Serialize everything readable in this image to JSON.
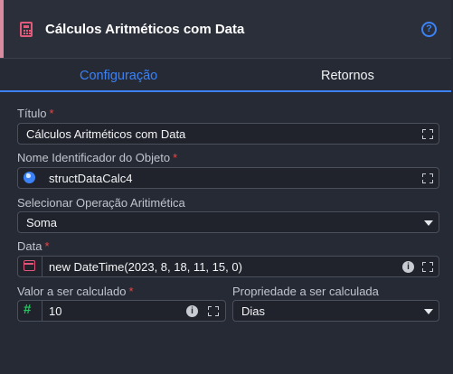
{
  "header": {
    "title": "Cálculos Aritméticos com Data",
    "accent_color": "#d98ca0",
    "icon": "calculator-icon",
    "help_icon": "help-circle-icon"
  },
  "tabs": [
    {
      "label": "Configuração",
      "active": true
    },
    {
      "label": "Retornos",
      "active": false
    }
  ],
  "form": {
    "titulo": {
      "label": "Título",
      "required": "*",
      "value": "Cálculos Aritméticos com Data"
    },
    "nome": {
      "label": "Nome Identificador do Objeto",
      "required": "*",
      "value": "structDataCalc4"
    },
    "operacao": {
      "label": "Selecionar Operação Aritimética",
      "value": "Soma"
    },
    "data": {
      "label": "Data",
      "required": "*",
      "value": "new DateTime(2023, 8, 18, 11, 15, 0)"
    },
    "valor": {
      "label": "Valor a ser calculado",
      "required": "*",
      "value": "10"
    },
    "propriedade": {
      "label": "Propriedade a ser calculada",
      "value": "Dias"
    }
  },
  "colors": {
    "accent_blue": "#3b82f6",
    "required_red": "#ef4444",
    "calendar_pink": "#e0557a",
    "number_green": "#22c55e"
  }
}
